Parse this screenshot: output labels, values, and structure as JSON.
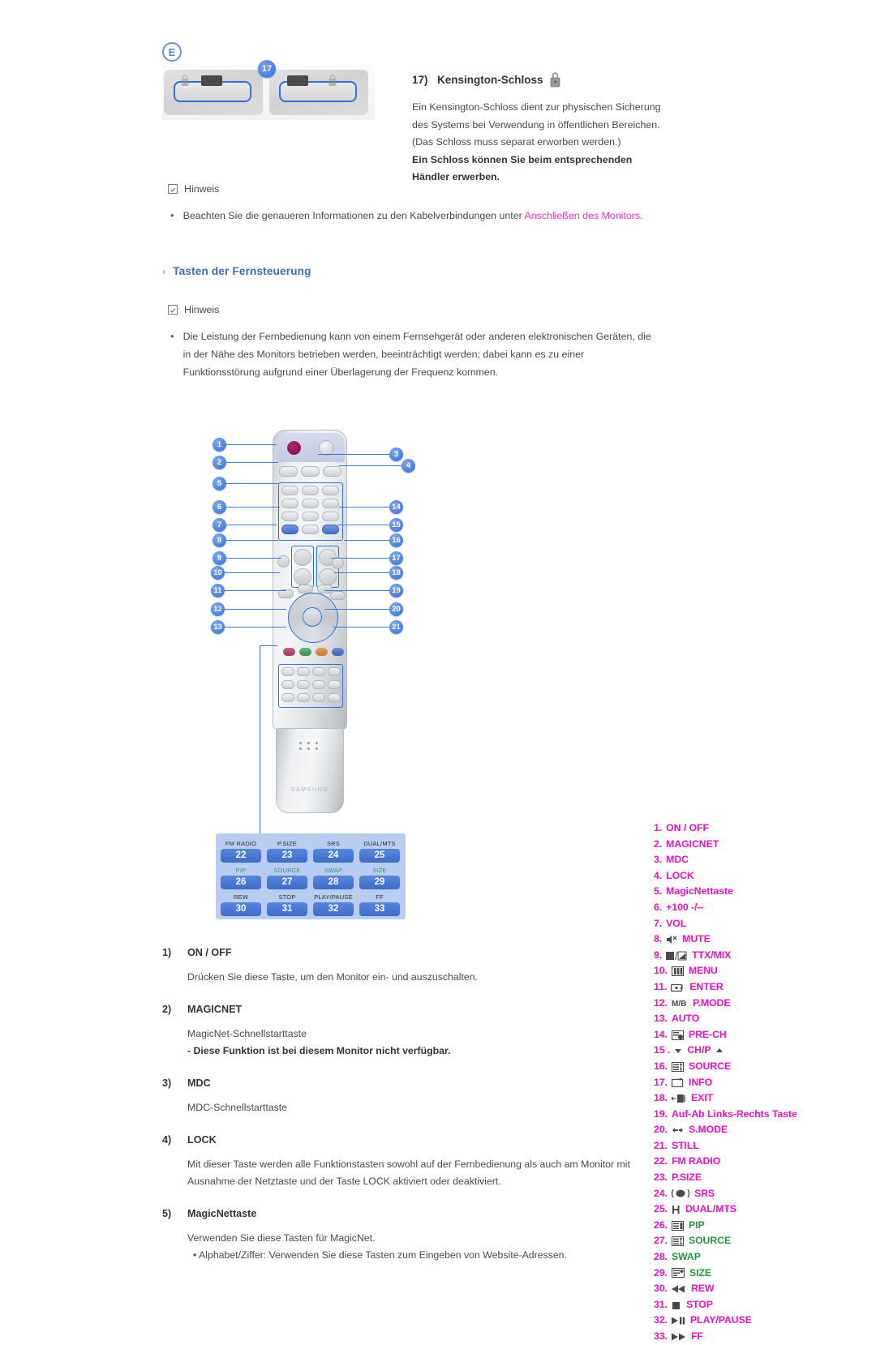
{
  "top_item": {
    "badge": "E",
    "callout_number": "17",
    "number": "17)",
    "title": "Kensington-Schloss",
    "lock_icon": "padlock-icon",
    "lines": [
      "Ein Kensington-Schloss dient zur physischen Sicherung",
      "des Systems bei Verwendung in öffentlichen Bereichen.",
      "(Das Schloss muss separat erworben werden.)"
    ],
    "bold_lines": [
      "Ein Schloss können Sie beim entsprechenden",
      "Händler erwerben."
    ]
  },
  "note1": {
    "label": "Hinweis",
    "bullet": "•",
    "text_before": "Beachten Sie die genaueren Informationen zu den Kabelverbindungen unter ",
    "link": "Anschließen des Monitors",
    "text_after": "."
  },
  "section_heading": {
    "arrow": "›",
    "title": "Tasten der Fernsteuerung"
  },
  "note2": {
    "label": "Hinweis",
    "bullet": "•",
    "lines": [
      "Die Leistung der Fernbedienung kann von einem Fernsehgerät oder anderen elektronischen Geräten, die",
      "in der Nähe des Monitors betrieben werden, beeinträchtigt werden; dabei kann es zu einer",
      "Funktionsstörung aufgrund einer Überlagerung der Frequenz kommen."
    ]
  },
  "remote": {
    "brand": "SAMSUNG",
    "callouts": [
      "1",
      "2",
      "3",
      "4",
      "5",
      "6",
      "7",
      "8",
      "9",
      "10",
      "11",
      "12",
      "13",
      "14",
      "15",
      "16",
      "17",
      "18",
      "19",
      "20",
      "21"
    ],
    "blue_panel": [
      {
        "label": "FM RADIO",
        "num": "22",
        "green": false
      },
      {
        "label": "P.SIZE",
        "num": "23",
        "green": false
      },
      {
        "label": "SRS",
        "num": "24",
        "green": false
      },
      {
        "label": "DUAL/MTS",
        "num": "25",
        "green": false
      },
      {
        "label": "PIP",
        "num": "26",
        "green": true
      },
      {
        "label": "SOURCE",
        "num": "27",
        "green": true
      },
      {
        "label": "SWAP",
        "num": "28",
        "green": true
      },
      {
        "label": "SIZE",
        "num": "29",
        "green": true
      },
      {
        "label": "REW",
        "num": "30",
        "green": false
      },
      {
        "label": "STOP",
        "num": "31",
        "green": false
      },
      {
        "label": "PLAY/PAUSE",
        "num": "32",
        "green": false
      },
      {
        "label": "FF",
        "num": "33",
        "green": false
      }
    ]
  },
  "legend": {
    "accent_color": "#f012c8",
    "green_color": "#1f9c3f",
    "items": [
      {
        "num": "1.",
        "label": "ON / OFF",
        "icon": null,
        "green": false
      },
      {
        "num": "2.",
        "label": "MAGICNET",
        "icon": null,
        "green": false
      },
      {
        "num": "3.",
        "label": "MDC",
        "icon": null,
        "green": false
      },
      {
        "num": "4.",
        "label": "LOCK",
        "icon": null,
        "green": false
      },
      {
        "num": "5.",
        "label": "MagicNettaste",
        "icon": null,
        "green": false
      },
      {
        "num": "6.",
        "label": "+100 -/--",
        "icon": null,
        "green": false
      },
      {
        "num": "7.",
        "label": "VOL",
        "icon": null,
        "green": false
      },
      {
        "num": "8.",
        "label": "MUTE",
        "icon": "mute-icon",
        "green": false
      },
      {
        "num": "9.",
        "label": "TTX/MIX",
        "icon": "ttx-mix-icon",
        "green": false
      },
      {
        "num": "10.",
        "label": "MENU",
        "icon": "menu-icon",
        "green": false
      },
      {
        "num": "11.",
        "label": "ENTER",
        "icon": "enter-icon",
        "green": false
      },
      {
        "num": "12.",
        "label": "P.MODE",
        "icon": "mb-icon",
        "green": false
      },
      {
        "num": "13.",
        "label": "AUTO",
        "icon": null,
        "green": false
      },
      {
        "num": "14.",
        "label": "PRE-CH",
        "icon": "pre-ch-icon",
        "green": false
      },
      {
        "num": "15 .",
        "label": "CH/P",
        "icon": "ch-p-icon",
        "green": false
      },
      {
        "num": "16.",
        "label": "SOURCE",
        "icon": "source-icon",
        "green": false
      },
      {
        "num": "17.",
        "label": "INFO",
        "icon": "info-icon",
        "green": false
      },
      {
        "num": "18.",
        "label": "EXIT",
        "icon": "exit-icon",
        "green": false
      },
      {
        "num": "19.",
        "label": "Auf-Ab Links-Rechts Taste",
        "icon": null,
        "green": false
      },
      {
        "num": "20.",
        "label": "S.MODE",
        "icon": "s-mode-icon",
        "green": false
      },
      {
        "num": "21.",
        "label": "STILL",
        "icon": null,
        "green": false
      },
      {
        "num": "22.",
        "label": "FM RADIO",
        "icon": null,
        "green": false
      },
      {
        "num": "23.",
        "label": "P.SIZE",
        "icon": null,
        "green": false
      },
      {
        "num": "24.",
        "label": "SRS",
        "icon": "srs-icon",
        "green": false
      },
      {
        "num": "25.",
        "label": "DUAL/MTS",
        "icon": "dual-mts-icon",
        "green": false
      },
      {
        "num": "26.",
        "label": "PIP",
        "icon": "pip-icon",
        "green": true
      },
      {
        "num": "27.",
        "label": "SOURCE",
        "icon": "source-icon",
        "green": true
      },
      {
        "num": "28.",
        "label": "SWAP",
        "icon": null,
        "green": true
      },
      {
        "num": "29.",
        "label": "SIZE",
        "icon": "size-icon",
        "green": true
      },
      {
        "num": "30.",
        "label": "REW",
        "icon": "rewind-icon",
        "green": false
      },
      {
        "num": "31.",
        "label": "STOP",
        "icon": "stop-icon",
        "green": false
      },
      {
        "num": "32.",
        "label": "PLAY/PAUSE",
        "icon": "play-pause-icon",
        "green": false
      },
      {
        "num": "33.",
        "label": "FF",
        "icon": "fast-forward-icon",
        "green": false
      }
    ]
  },
  "descriptions": [
    {
      "num": "1)",
      "title": "ON / OFF",
      "body": [
        "Drücken Sie diese Taste, um den Monitor ein- und auszuschalten."
      ],
      "bold": []
    },
    {
      "num": "2)",
      "title": "MAGICNET",
      "body": [
        "MagicNet-Schnellstarttaste"
      ],
      "bold": [
        "- Diese Funktion ist bei diesem Monitor nicht verfügbar."
      ]
    },
    {
      "num": "3)",
      "title": "MDC",
      "body": [
        "MDC-Schnellstarttaste"
      ],
      "bold": []
    },
    {
      "num": "4)",
      "title": "LOCK",
      "body": [
        "Mit dieser Taste werden alle Funktionstasten sowohl auf der Fernbedienung als auch am Monitor mit",
        "Ausnahme der Netztaste und der Taste LOCK aktiviert oder deaktiviert."
      ],
      "bold": []
    },
    {
      "num": "5)",
      "title": "MagicNettaste",
      "body": [
        "Verwenden Sie diese Tasten für MagicNet."
      ],
      "sub": [
        "• Alphabet/Ziffer: Verwenden Sie diese Tasten zum Eingeben von Website-Adressen."
      ],
      "bold": []
    }
  ]
}
